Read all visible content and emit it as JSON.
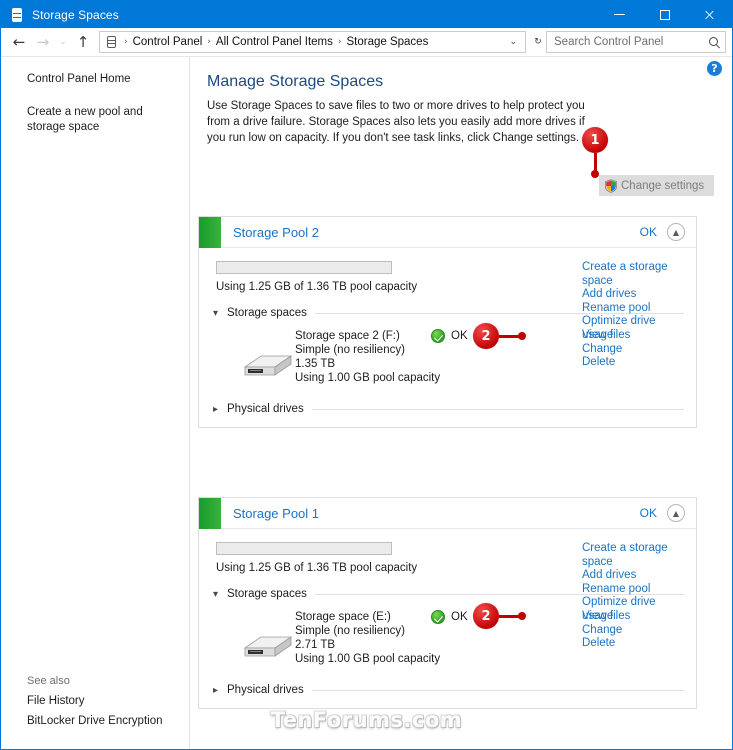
{
  "window": {
    "title": "Storage Spaces",
    "title_icon": "storage-disks-icon",
    "minimize_label": "–",
    "maximize_label": "",
    "close_label": "×"
  },
  "navbar": {
    "back_label": "←",
    "forward_label": "→",
    "recent_label": "⌄",
    "up_label": "↑",
    "address_icon": "storage-disks-icon",
    "breadcrumbs": [
      "Control Panel",
      "All Control Panel Items",
      "Storage Spaces"
    ],
    "separator": "›",
    "dropdown_label": "⌄",
    "refresh_label": "↻",
    "search_placeholder": "Search Control Panel",
    "search_value": "",
    "search_icon": "search-icon"
  },
  "sidebar": {
    "links": [
      {
        "label": "Control Panel Home"
      },
      {
        "label": "Create a new pool and storage space"
      }
    ],
    "see_also_title": "See also",
    "see_also_links": [
      {
        "label": "File History"
      },
      {
        "label": "BitLocker Drive Encryption"
      }
    ]
  },
  "content": {
    "help_icon": "help-question-icon",
    "help_label": "?",
    "title": "Manage Storage Spaces",
    "description": "Use Storage Spaces to save files to two or more drives to help protect you from a drive failure. Storage Spaces also lets you easily add more drives if you run low on capacity. If you don't see task links, click Change settings.",
    "change_settings_label": "Change settings",
    "change_settings_icon": "uac-shield-icon"
  },
  "callouts": [
    {
      "number": "1",
      "style": "vertical"
    },
    {
      "number": "2",
      "style": "horizontal"
    },
    {
      "number": "2",
      "style": "horizontal"
    }
  ],
  "pools": [
    {
      "name": "Storage Pool 2",
      "status": "OK",
      "collapse_icon": "chevron-up-icon",
      "capacity_text": "Using 1.25 GB of 1.36 TB pool capacity",
      "capacity_percent": 0,
      "tasks": [
        "Create a storage space",
        "Add drives",
        "Rename pool",
        "Optimize drive usage"
      ],
      "sections": {
        "storage_spaces_label": "Storage spaces",
        "storage_spaces_chevron": "chevron-down-icon",
        "physical_drives_label": "Physical drives",
        "physical_drives_chevron": "chevron-right-icon"
      },
      "spaces": [
        {
          "icon": "external-hard-drive-icon",
          "name": "Storage space 2 (F:)",
          "resiliency": "Simple (no resiliency)",
          "size": "1.35 TB",
          "usage": "Using 1.00 GB pool capacity",
          "status": "OK",
          "status_icon": "ok-check-icon",
          "actions": [
            "View files",
            "Change",
            "Delete"
          ]
        }
      ]
    },
    {
      "name": "Storage Pool 1",
      "status": "OK",
      "collapse_icon": "chevron-up-icon",
      "capacity_text": "Using 1.25 GB of 1.36 TB pool capacity",
      "capacity_percent": 0,
      "tasks": [
        "Create a storage space",
        "Add drives",
        "Rename pool",
        "Optimize drive usage"
      ],
      "sections": {
        "storage_spaces_label": "Storage spaces",
        "storage_spaces_chevron": "chevron-down-icon",
        "physical_drives_label": "Physical drives",
        "physical_drives_chevron": "chevron-right-icon"
      },
      "spaces": [
        {
          "icon": "external-hard-drive-icon",
          "name": "Storage space (E:)",
          "resiliency": "Simple (no resiliency)",
          "size": "2.71 TB",
          "usage": "Using 1.00 GB pool capacity",
          "status": "OK",
          "status_icon": "ok-check-icon",
          "actions": [
            "View files",
            "Change",
            "Delete"
          ]
        }
      ]
    }
  ],
  "watermark": "TenForums.com",
  "colors": {
    "titlebar": "#0078d7",
    "accent_link": "#1a73c4",
    "pool_accent": "#1a9b2a",
    "callout_red": "#c00000",
    "status_ok_green": "#2d9e22"
  }
}
